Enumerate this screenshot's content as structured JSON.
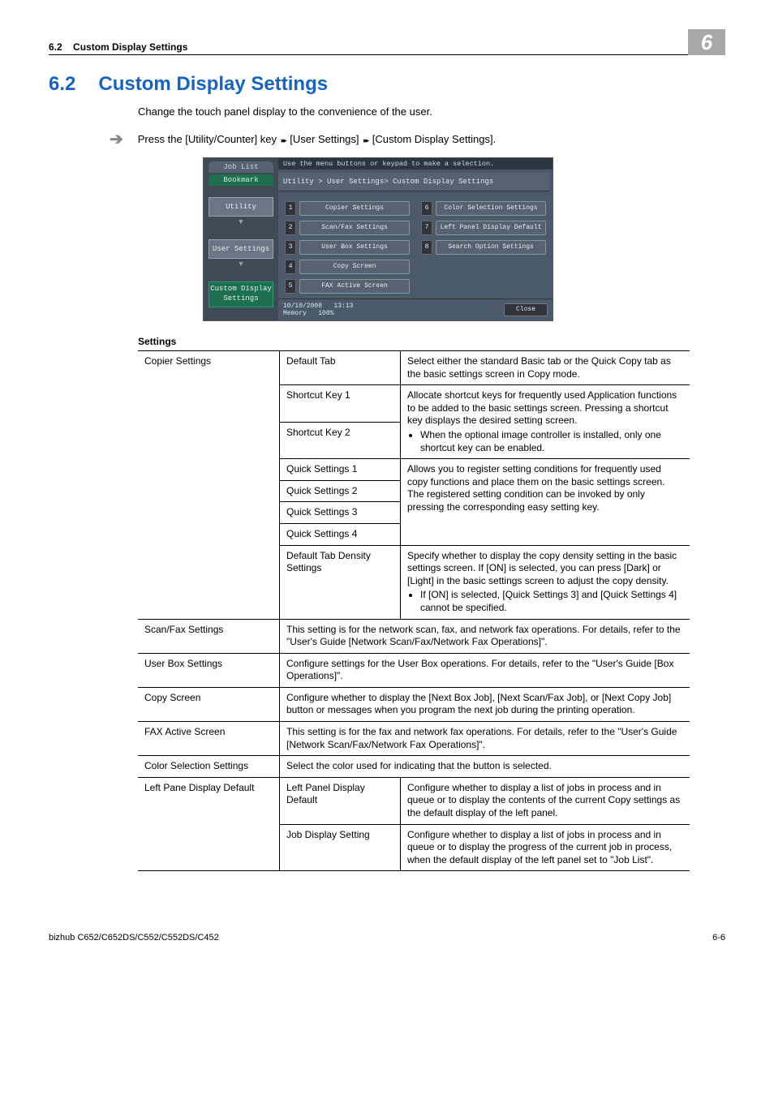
{
  "header": {
    "section_num": "6.2",
    "section_name_top": "Custom Display Settings",
    "chapter_num": "6"
  },
  "title": {
    "num": "6.2",
    "text": "Custom Display Settings"
  },
  "intro": "Change the touch panel display to the convenience of the user.",
  "instruction": {
    "prefix": "Press the [Utility/Counter] key ",
    "sep": "▸▸",
    "part2": " [User Settings] ",
    "part3": " [Custom Display Settings]."
  },
  "screenshot": {
    "tab_joblist": "Job List",
    "tab_bookmark": "Bookmark",
    "btn_utility": "Utility",
    "btn_usersettings": "User Settings",
    "btn_custom": "Custom Display\nSettings",
    "topbar": "Use the menu buttons or keypad to make a selection.",
    "breadcrumb": "Utility > User Settings> Custom Display Settings",
    "items_left": [
      {
        "n": "1",
        "t": "Copier Settings"
      },
      {
        "n": "2",
        "t": "Scan/Fax Settings"
      },
      {
        "n": "3",
        "t": "User Box Settings"
      },
      {
        "n": "4",
        "t": "Copy Screen"
      },
      {
        "n": "5",
        "t": "FAX Active Screen"
      }
    ],
    "items_right": [
      {
        "n": "6",
        "t": "Color Selection Settings"
      },
      {
        "n": "7",
        "t": "Left Panel Display Default"
      },
      {
        "n": "8",
        "t": "Search Option Settings"
      }
    ],
    "footer_date": "10/10/2008",
    "footer_time": "13:13",
    "footer_mem": "Memory",
    "footer_pct": "100%",
    "footer_close": "Close"
  },
  "settings_label": "Settings",
  "table": {
    "copier_settings": "Copier Settings",
    "default_tab": "Default Tab",
    "default_tab_desc": "Select either the standard Basic tab or the Quick Copy tab as the basic settings screen in Copy mode.",
    "sk1": "Shortcut Key 1",
    "sk2": "Shortcut Key 2",
    "sk_desc_1": "Allocate shortcut keys for frequently used Application functions to be added to the basic settings screen. Pressing a shortcut key displays the desired setting screen.",
    "sk_desc_bullet": "When the optional image controller is installed, only one shortcut key can be enabled.",
    "qs1": "Quick Settings 1",
    "qs2": "Quick Settings 2",
    "qs3": "Quick Settings 3",
    "qs4": "Quick Settings 4",
    "qs_desc": "Allows you to register setting conditions for frequently used copy functions and place them on the basic settings screen. The registered setting condition can be invoked by only pressing the corresponding easy setting key.",
    "dtd": "Default Tab Density Settings",
    "dtd_desc": "Specify whether to display the copy density setting in the basic settings screen. If [ON] is selected, you can press [Dark] or [Light] in the basic settings screen to adjust the copy density.",
    "dtd_bullet": "If [ON] is selected, [Quick Settings 3] and [Quick Settings 4] cannot be specified.",
    "scanfax": "Scan/Fax Settings",
    "scanfax_desc": "This setting is for the network scan, fax, and network fax operations. For details, refer to the \"User's Guide [Network Scan/Fax/Network Fax Operations]\".",
    "userbox": "User Box Settings",
    "userbox_desc": "Configure settings for the User Box operations. For details, refer to the \"User's Guide [Box Operations]\".",
    "copyscreen": "Copy Screen",
    "copyscreen_desc": "Configure whether to display the [Next Box Job], [Next Scan/Fax Job], or [Next Copy Job] button or messages when you program the next job during the printing operation.",
    "fax": "FAX Active Screen",
    "fax_desc": "This setting is for the fax and network fax operations. For details, refer to the \"User's Guide [Network Scan/Fax/Network Fax Operations]\".",
    "color": "Color Selection Settings",
    "color_desc": "Select the color used for indicating that the button is selected.",
    "leftpane": "Left Pane Display Default",
    "lpd": "Left Panel Display Default",
    "lpd_desc": "Configure whether to display a list of jobs in process and in queue or to display the contents of the current Copy settings as the default display of the left panel.",
    "jds": "Job Display Setting",
    "jds_desc": "Configure whether to display a list of jobs in process and in queue or to display the progress of the current job in process, when the default display of the left panel set to \"Job List\"."
  },
  "footer": {
    "left": "bizhub C652/C652DS/C552/C552DS/C452",
    "right": "6-6"
  }
}
